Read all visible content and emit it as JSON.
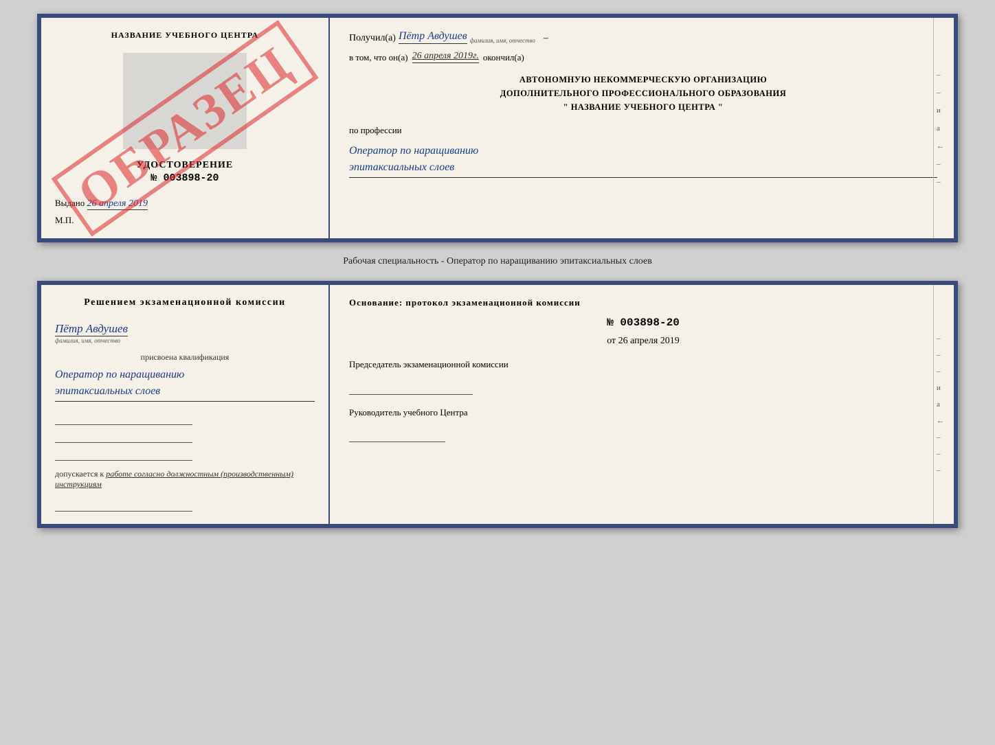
{
  "doc1": {
    "left": {
      "center_title": "НАЗВАНИЕ УЧЕБНОГО ЦЕНТРА",
      "obrazets": "ОБРАЗЕЦ",
      "udostoverenie_label": "УДОСТОВЕРЕНИЕ",
      "doc_number": "№ 003898-20",
      "vydano_label": "Выдано",
      "vydano_date": "26 апреля 2019",
      "mp": "М.П."
    },
    "right": {
      "poluchil_prefix": "Получил(а)",
      "recipient_name": "Пётр Авдушев",
      "recipient_sub": "фамилия, имя, отчество",
      "dash": "–",
      "vtom_prefix": "в том, что он(а)",
      "completion_date": "26 апреля 2019г.",
      "okончил": "окончил(а)",
      "org_line1": "АВТОНОМНУЮ НЕКОММЕРЧЕСКУЮ ОРГАНИЗАЦИЮ",
      "org_line2": "ДОПОЛНИТЕЛЬНОГО ПРОФЕССИОНАЛЬНОГО ОБРАЗОВАНИЯ",
      "org_name_quotes": "\"  НАЗВАНИЕ УЧЕБНОГО ЦЕНТРА  \"",
      "po_professii": "по профессии",
      "profession_line1": "Оператор по наращиванию",
      "profession_line2": "эпитаксиальных слоев"
    }
  },
  "specialty_label": "Рабочая специальность - Оператор по наращиванию эпитаксиальных слоев",
  "doc2": {
    "left": {
      "resheniem_title": "Решением  экзаменационной  комиссии",
      "fio_name": "Пётр Авдушев",
      "fio_sub": "фамилия, имя, отчество",
      "prisvoena": "присвоена квалификация",
      "qualification_line1": "Оператор по наращиванию",
      "qualification_line2": "эпитаксиальных слоев",
      "dopuskaetsya_prefix": "допускается к",
      "dopuskaetsya_text": "работе согласно должностным (производственным) инструкциям"
    },
    "right": {
      "osnovanie_title": "Основание: протокол экзаменационной  комиссии",
      "protocol_number": "№  003898-20",
      "protocol_date_prefix": "от",
      "protocol_date": "26 апреля 2019",
      "predsedatel_label": "Председатель экзаменационной комиссии",
      "rukovoditel_label": "Руководитель учебного Центра"
    },
    "right_marks": [
      "–",
      "–",
      "–",
      "и",
      "а",
      "←",
      "–",
      "–",
      "–"
    ]
  },
  "doc1_right_marks": [
    "–",
    "–",
    "и",
    "а",
    "←",
    "–",
    "–"
  ]
}
